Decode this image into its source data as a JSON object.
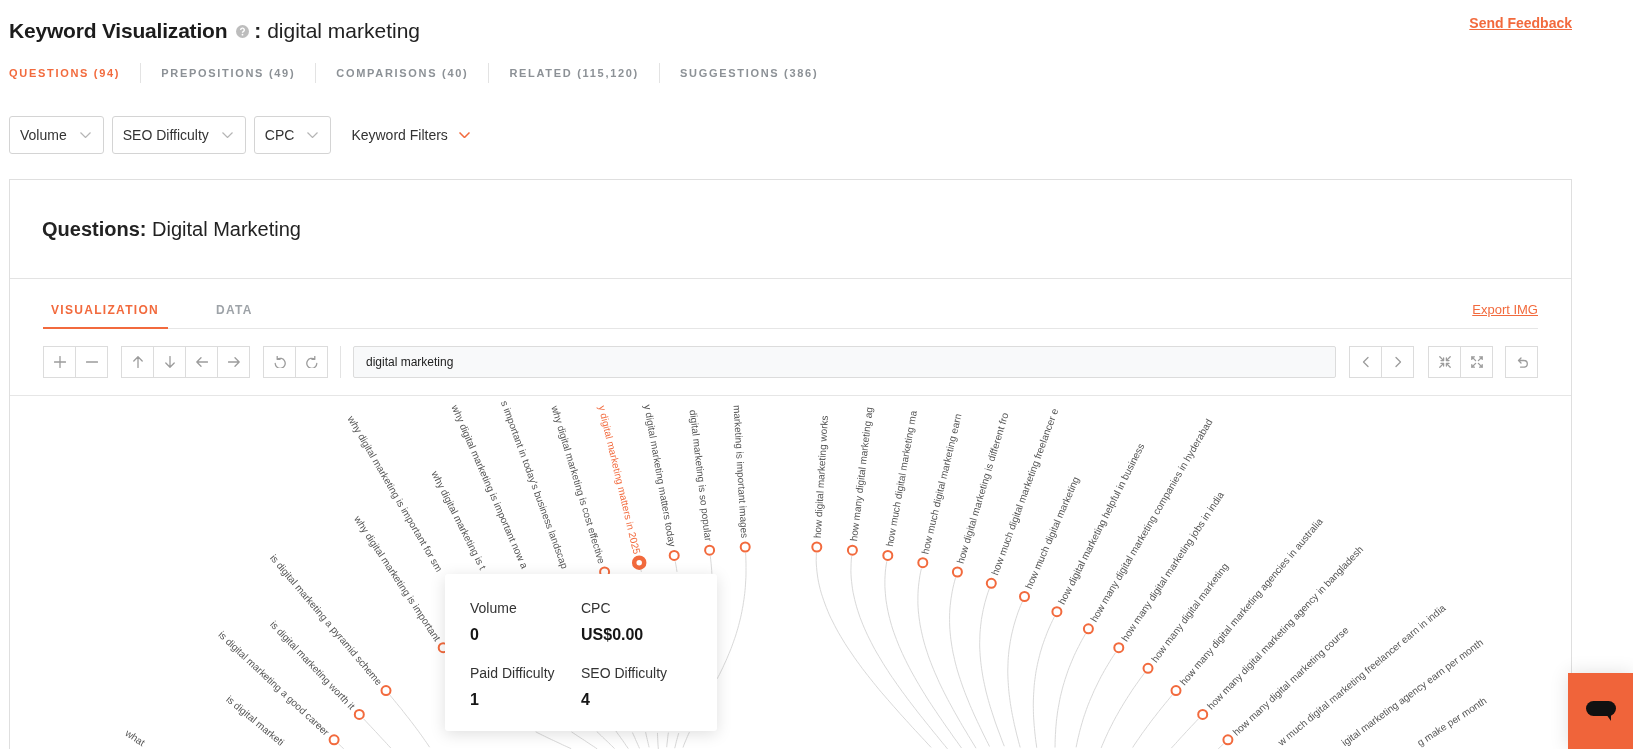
{
  "header": {
    "title": "Keyword Visualization",
    "keyword": "**:** digital marketing",
    "feedback_link": "Send Feedback"
  },
  "tabs": [
    {
      "label": "QUESTIONS (94)",
      "selected": true
    },
    {
      "label": "PREPOSITIONS (49)",
      "selected": false
    },
    {
      "label": "COMPARISONS (40)",
      "selected": false
    },
    {
      "label": "RELATED (115,120)",
      "selected": false
    },
    {
      "label": "SUGGESTIONS (386)",
      "selected": false
    }
  ],
  "filters": [
    {
      "label": "Volume",
      "kind": "dropdown"
    },
    {
      "label": "SEO Difficulty",
      "kind": "dropdown"
    },
    {
      "label": "CPC",
      "kind": "dropdown"
    },
    {
      "label": "Keyword Filters",
      "kind": "menu"
    }
  ],
  "card": {
    "title": "**Questions:** Digital Marketing",
    "view_tabs": [
      {
        "label": "VISUALIZATION",
        "selected": true
      },
      {
        "label": "DATA",
        "selected": false
      }
    ],
    "export_link": "Export IMG",
    "search": {
      "value": "digital marketing"
    }
  },
  "diagram": {
    "branches": [
      {
        "children": [
          {
            "label": "what",
            "selected": false
          }
        ]
      },
      {
        "children": [
          {
            "label": "is digital marketi",
            "selected": false
          },
          {
            "label": "is digital marketing a good career",
            "selected": false
          },
          {
            "label": "is digital marketing worth it",
            "selected": false
          },
          {
            "label": "is digital marketing a pyramid scheme",
            "selected": false
          }
        ]
      },
      {
        "children": [
          {
            "label": "why digital marketing is important",
            "selected": false
          },
          {
            "label": "why digital marketing is important for sm",
            "selected": false
          },
          {
            "label": "why digital marketing is t",
            "selected": false
          },
          {
            "label": "why digital marketing is important now a",
            "selected": false
          },
          {
            "label": "s important in today's business landscap",
            "selected": false
          },
          {
            "label": "why digital marketing is cost effective",
            "selected": false
          },
          {
            "label": "y digital marketing matters in 2025",
            "selected": true
          },
          {
            "label": "y digital marketing matters today",
            "selected": false
          },
          {
            "label": "digital marketing is so popular",
            "selected": false
          },
          {
            "label": "marketing is important images",
            "selected": false
          }
        ]
      },
      {
        "children": [
          {
            "label": "how digital marketing works",
            "selected": false
          },
          {
            "label": "how many digital marketing ag",
            "selected": false
          },
          {
            "label": "how much digital marketing ma",
            "selected": false
          },
          {
            "label": "how much digital marketing earn",
            "selected": false
          },
          {
            "label": "how digital marketing is different fro",
            "selected": false
          },
          {
            "label": "how much digital marketing freelancer e",
            "selected": false
          },
          {
            "label": "how much digital marketing",
            "selected": false
          },
          {
            "label": "how digital marketing helpful in business",
            "selected": false
          },
          {
            "label": "how many digital marketing companies in hyderabad",
            "selected": false
          },
          {
            "label": "how many digital marketing jobs in india",
            "selected": false
          },
          {
            "label": "how many digital marketing",
            "selected": false
          },
          {
            "label": "how many digital marketing agencies in australia",
            "selected": false
          },
          {
            "label": "how many digital marketing agency in bangladesh",
            "selected": false
          },
          {
            "label": "how many digital marketing course",
            "selected": false
          },
          {
            "label": "w much digital marketing freelancer earn in india",
            "selected": false
          },
          {
            "label": "igital marketing agency earn per month",
            "selected": false
          },
          {
            "label": "g make per month",
            "selected": false
          }
        ]
      }
    ]
  },
  "tooltip": {
    "metrics": [
      {
        "label": "Volume",
        "value": "0"
      },
      {
        "label": "CPC",
        "value": "US$0.00"
      },
      {
        "label": "Paid Difficulty",
        "value": "1"
      },
      {
        "label": "SEO Difficulty",
        "value": "4"
      }
    ]
  }
}
